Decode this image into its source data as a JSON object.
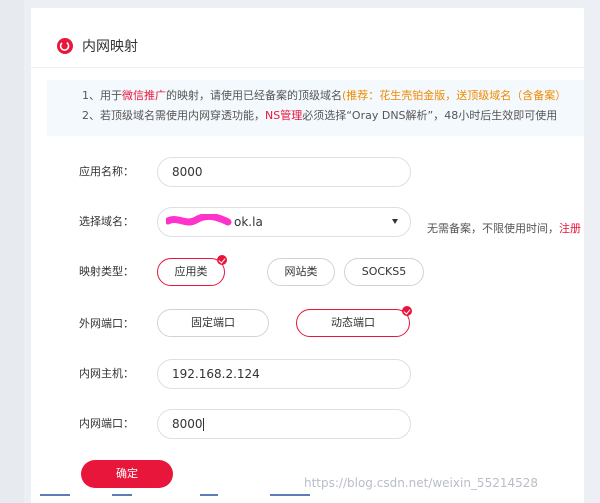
{
  "header": {
    "title": "内网映射",
    "icon": "logo-icon"
  },
  "notice": {
    "line1": {
      "a": "1、用于",
      "b": "微信推广",
      "c": "的映射，请使用已经备案的顶级域名",
      "d": "(推荐：花生壳铂金版，送顶级域名（含备案）"
    },
    "line2": {
      "a": "2、若顶级域名需使用内网穿透功能，",
      "b": "NS管理",
      "c": "必须选择“Oray DNS解析”，48小时后生效即可使用"
    }
  },
  "form": {
    "app_name": {
      "label": "应用名称：",
      "value": "8000"
    },
    "domain": {
      "label": "选择域名：",
      "value": "ok.la",
      "hint_a": "无需备案，不限使用时间，",
      "hint_b": "注册"
    },
    "mapping_type": {
      "label": "映射类型：",
      "options": [
        "应用类",
        "网站类",
        "SOCKS5"
      ],
      "selected": "应用类"
    },
    "external_port": {
      "label": "外网端口：",
      "options": [
        "固定端口",
        "动态端口"
      ],
      "selected": "动态端口"
    },
    "internal_host": {
      "label": "内网主机：",
      "value": "192.168.2.124"
    },
    "internal_port": {
      "label": "内网端口：",
      "value": "8000"
    },
    "confirm_label": "确定"
  },
  "watermark": "https://blog.csdn.net/weixin_55214528",
  "colors": {
    "accent": "#e8163b",
    "highlight": "#f08a00",
    "redaction": "#ff33cc"
  }
}
